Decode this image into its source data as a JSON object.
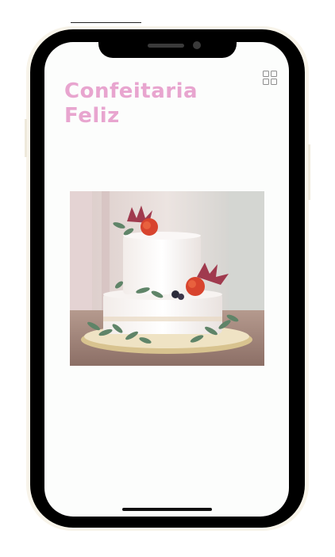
{
  "app": {
    "title": "Confeitaria Feliz"
  },
  "header": {
    "menu_icon": "grid-icon"
  },
  "hero": {
    "image_subject": "cake-photo"
  },
  "colors": {
    "title": "#e8a5cf",
    "screen_bg": "#fcfdfc",
    "frame": "#000000"
  }
}
